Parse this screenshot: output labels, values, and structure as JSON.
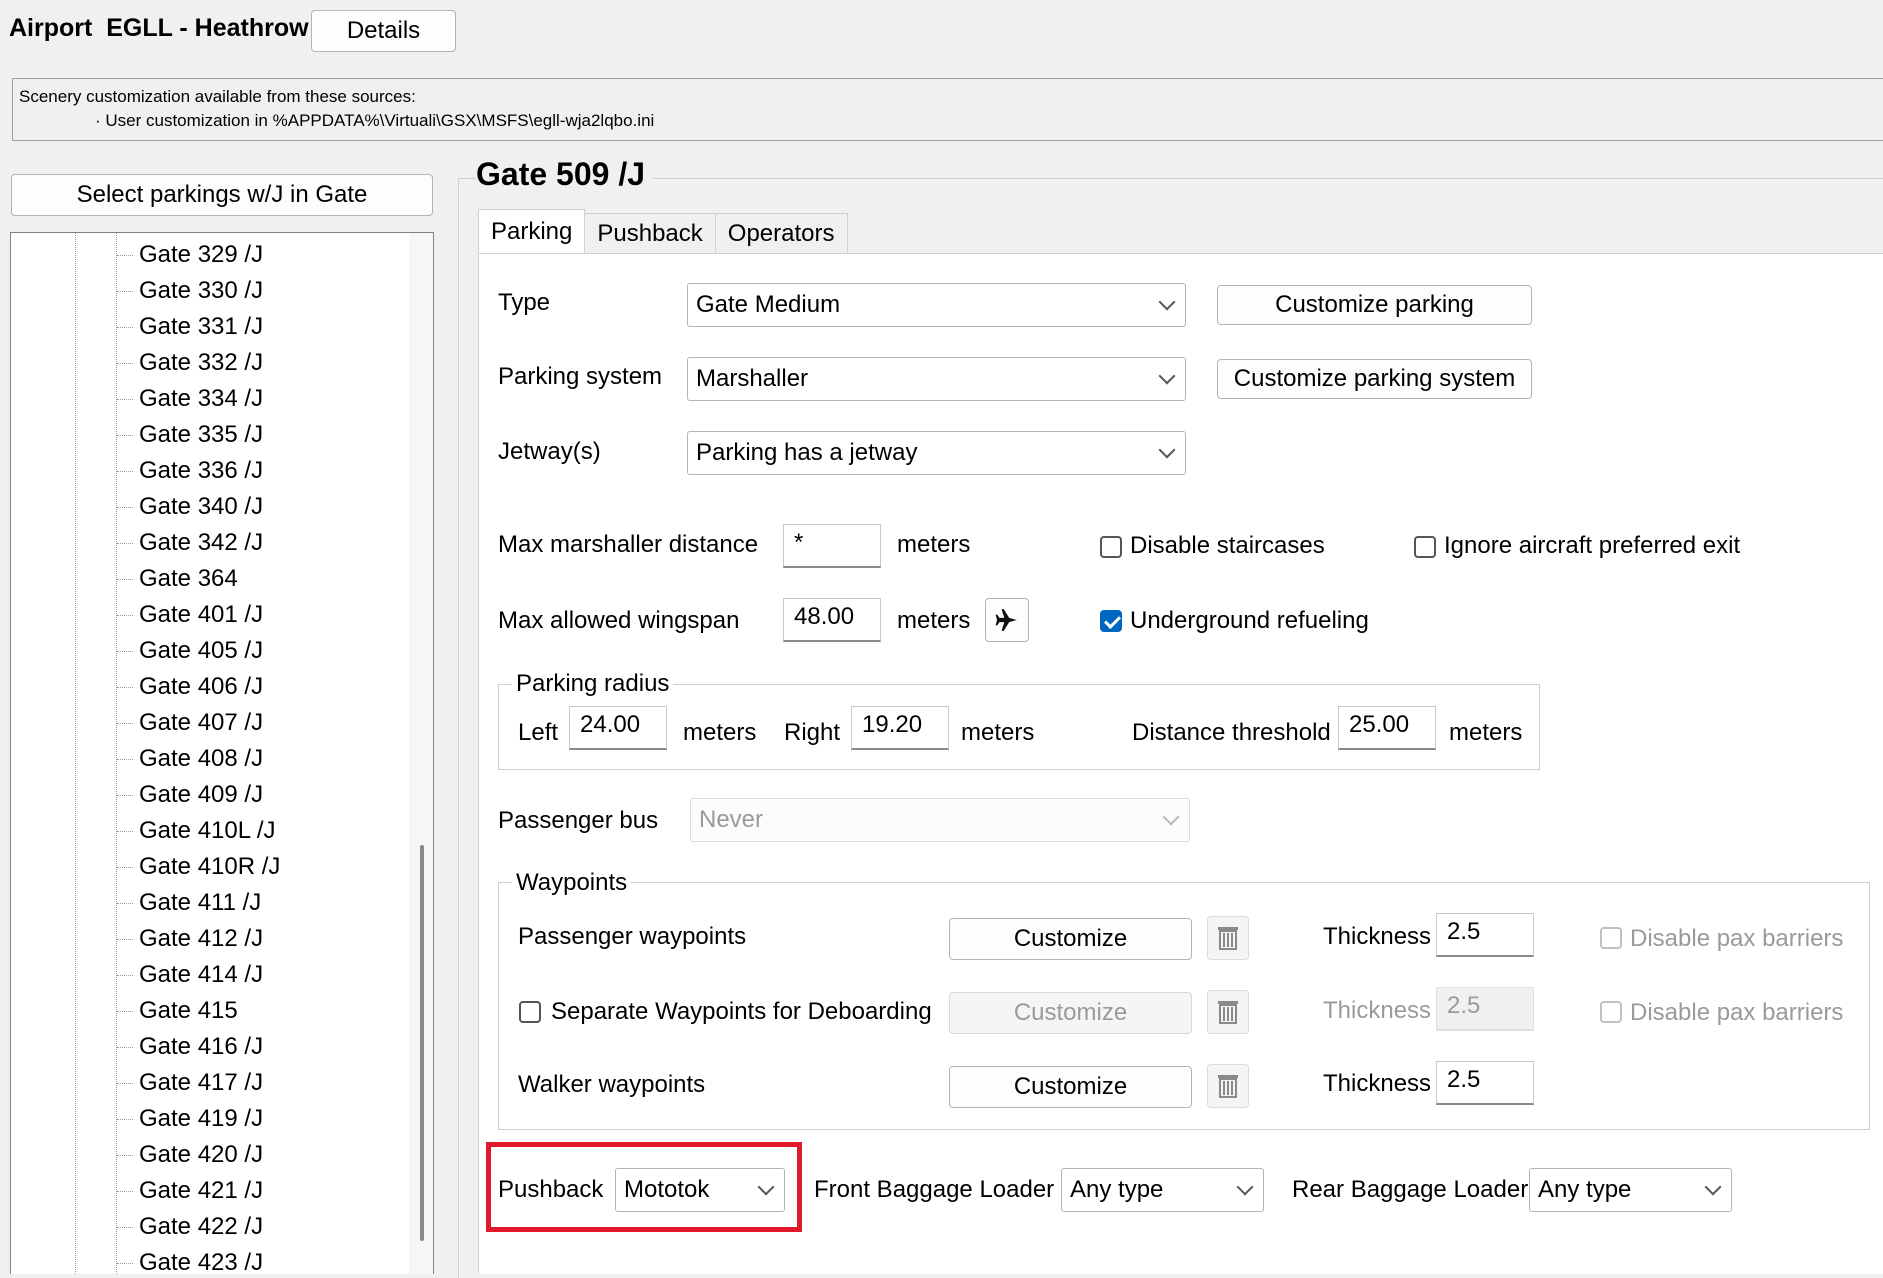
{
  "airport": {
    "label": "Airport  EGLL - Heathrow",
    "details_button": "Details"
  },
  "scenery_info": {
    "line1": "Scenery customization available from these sources:",
    "line2": "· User customization in %APPDATA%\\Virtuali\\GSX\\MSFS\\egll-wja2lqbo.ini"
  },
  "select_parkings_button": "Select parkings w/J in Gate",
  "tree": {
    "items": [
      "Gate 329 /J",
      "Gate 330 /J",
      "Gate 331 /J",
      "Gate 332 /J",
      "Gate 334 /J",
      "Gate 335 /J",
      "Gate 336 /J",
      "Gate 340 /J",
      "Gate 342 /J",
      "Gate 364",
      "Gate 401 /J",
      "Gate 405 /J",
      "Gate 406 /J",
      "Gate 407 /J",
      "Gate 408 /J",
      "Gate 409 /J",
      "Gate 410L /J",
      "Gate 410R /J",
      "Gate 411 /J",
      "Gate 412 /J",
      "Gate 414 /J",
      "Gate 415",
      "Gate 416 /J",
      "Gate 417 /J",
      "Gate 419 /J",
      "Gate 420 /J",
      "Gate 421 /J",
      "Gate 422 /J",
      "Gate 423 /J"
    ]
  },
  "gate_title": "Gate 509 /J",
  "tabs": [
    {
      "label": "Parking",
      "active": true
    },
    {
      "label": "Pushback",
      "active": false
    },
    {
      "label": "Operators",
      "active": false
    }
  ],
  "parking": {
    "type_label": "Type",
    "type_value": "Gate Medium",
    "customize_parking": "Customize parking",
    "system_label": "Parking system",
    "system_value": "Marshaller",
    "customize_system": "Customize parking system",
    "jetway_label": "Jetway(s)",
    "jetway_value": "Parking has a jetway",
    "max_marshaller_label": "Max marshaller distance",
    "max_marshaller_value": "*",
    "meters": "meters",
    "disable_staircases": "Disable staircases",
    "disable_staircases_checked": false,
    "ignore_exit": "Ignore aircraft preferred exit",
    "ignore_exit_checked": false,
    "max_wingspan_label": "Max allowed wingspan",
    "max_wingspan_value": "48.00",
    "underground_refueling": "Underground refueling",
    "underground_refueling_checked": true,
    "radius": {
      "legend": "Parking radius",
      "left_label": "Left",
      "left_value": "24.00",
      "right_label": "Right",
      "right_value": "19.20",
      "threshold_label": "Distance threshold",
      "threshold_value": "25.00"
    },
    "bus_label": "Passenger bus",
    "bus_value": "Never",
    "waypoints": {
      "legend": "Waypoints",
      "passenger_label": "Passenger waypoints",
      "customize": "Customize",
      "thickness_label": "Thickness",
      "passenger_thickness": "2.5",
      "disable_pax_barriers": "Disable pax barriers",
      "separate_label": "Separate Waypoints for Deboarding",
      "separate_thickness": "2.5",
      "walker_label": "Walker waypoints",
      "walker_thickness": "2.5"
    },
    "pushback_label": "Pushback",
    "pushback_value": "Mototok",
    "front_loader_label": "Front Baggage Loader",
    "front_loader_value": "Any type",
    "rear_loader_label": "Rear Baggage Loader",
    "rear_loader_value": "Any type"
  },
  "colors": {
    "highlight": "#e0192b",
    "checkbox_accent": "#0067c0"
  }
}
